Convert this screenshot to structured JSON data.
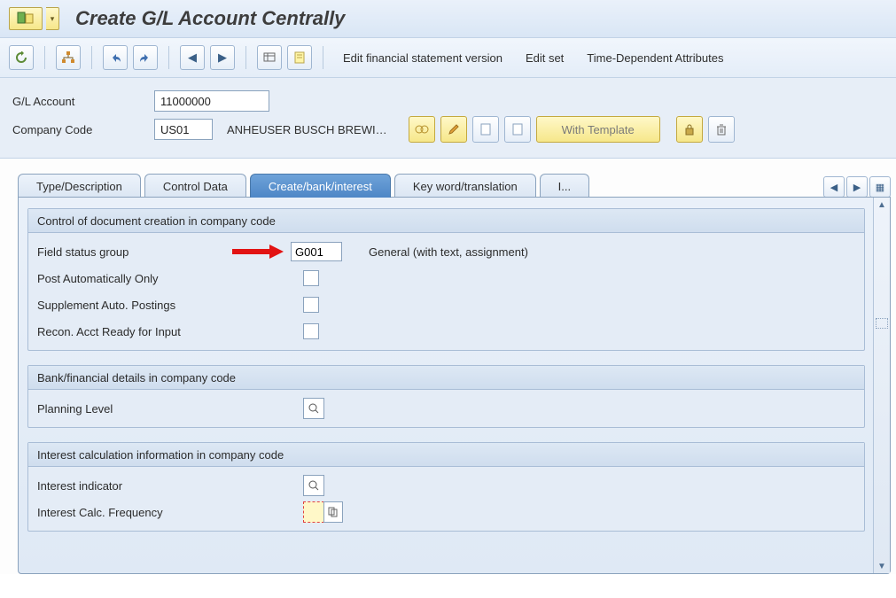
{
  "title": "Create G/L Account Centrally",
  "toolbar": {
    "links": [
      "Edit financial statement version",
      "Edit set",
      "Time-Dependent Attributes"
    ]
  },
  "header": {
    "gl_account_label": "G/L Account",
    "gl_account_value": "11000000",
    "company_code_label": "Company Code",
    "company_code_value": "US01",
    "company_code_desc": "ANHEUSER BUSCH BREWI…",
    "with_template_label": "With Template"
  },
  "tabs": {
    "t0": "Type/Description",
    "t1": "Control Data",
    "t2": "Create/bank/interest",
    "t3": "Key word/translation",
    "t4": "I..."
  },
  "group1": {
    "title": "Control of document creation in company code",
    "field_status_label": "Field status group",
    "field_status_value": "G001",
    "field_status_desc": "General (with text, assignment)",
    "post_auto_label": "Post Automatically Only",
    "supp_auto_label": "Supplement Auto. Postings",
    "recon_label": "Recon. Acct Ready for Input"
  },
  "group2": {
    "title": "Bank/financial details in company code",
    "planning_label": "Planning Level"
  },
  "group3": {
    "title": "Interest calculation information in company code",
    "interest_ind_label": "Interest indicator",
    "interest_freq_label": "Interest Calc. Frequency"
  }
}
